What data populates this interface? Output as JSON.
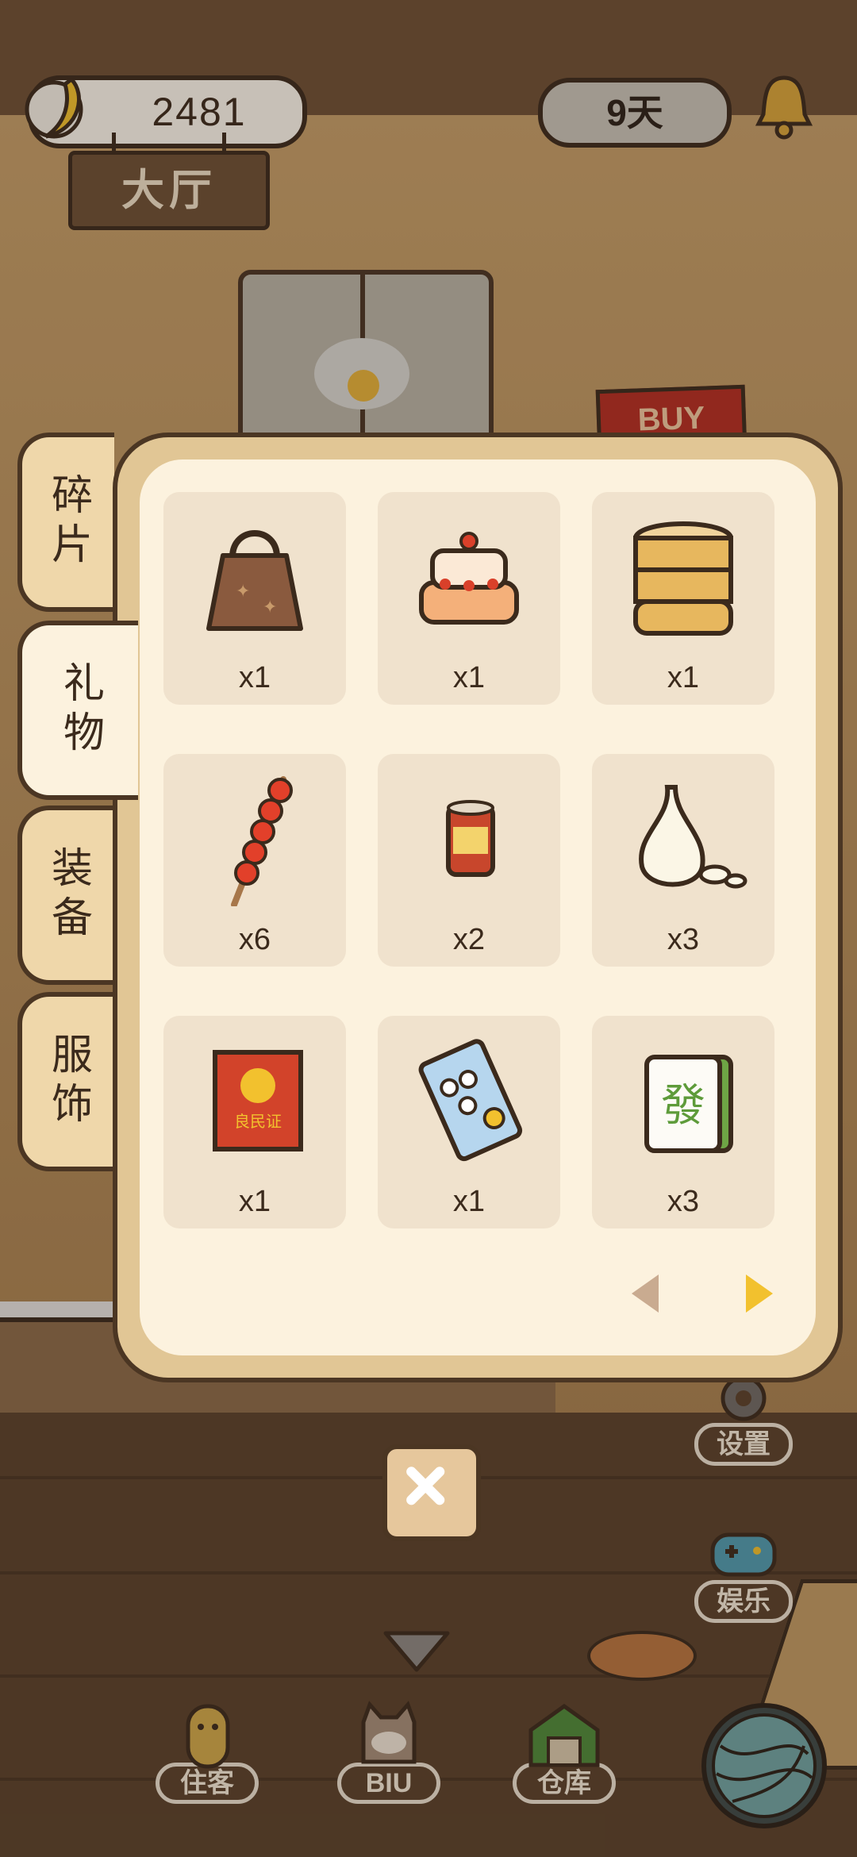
{
  "hud": {
    "coins": "2481",
    "days": "9天",
    "location": "大厅"
  },
  "side_buttons": [
    {
      "label": "设置",
      "icon": "gear-icon"
    },
    {
      "label": "娱乐",
      "icon": "gamepad-icon"
    }
  ],
  "bottom_nav": [
    {
      "label": "住客",
      "icon": "guest-icon"
    },
    {
      "label": "BIU",
      "icon": "cat-icon"
    },
    {
      "label": "仓库",
      "icon": "warehouse-icon"
    }
  ],
  "scene": {
    "buy_sign": "BUY"
  },
  "inventory": {
    "tabs": [
      {
        "label": "碎片",
        "active": false
      },
      {
        "label": "礼物",
        "active": true
      },
      {
        "label": "装备",
        "active": false
      },
      {
        "label": "服饰",
        "active": false
      }
    ],
    "items": [
      {
        "name": "handbag-icon",
        "qty": "x1"
      },
      {
        "name": "cake-icon",
        "qty": "x1"
      },
      {
        "name": "steamer-icon",
        "qty": "x1"
      },
      {
        "name": "candied-haws-icon",
        "qty": "x6"
      },
      {
        "name": "can-icon",
        "qty": "x2"
      },
      {
        "name": "garlic-icon",
        "qty": "x3"
      },
      {
        "name": "certificate-icon",
        "qty": "x1",
        "text": "良民证"
      },
      {
        "name": "snack-bag-icon",
        "qty": "x1"
      },
      {
        "name": "mahjong-tile-icon",
        "qty": "x3",
        "text": "發"
      }
    ],
    "pager": {
      "prev_icon": "triangle-left-icon",
      "next_icon": "triangle-right-icon"
    },
    "close_icon": "close-icon"
  },
  "colors": {
    "panel": "#e1c695",
    "panel_inner": "#fcf2de",
    "slot": "#f0e2cd",
    "outline": "#4b3623",
    "pager_next": "#f2c12e",
    "pager_prev": "#c9ab90"
  }
}
